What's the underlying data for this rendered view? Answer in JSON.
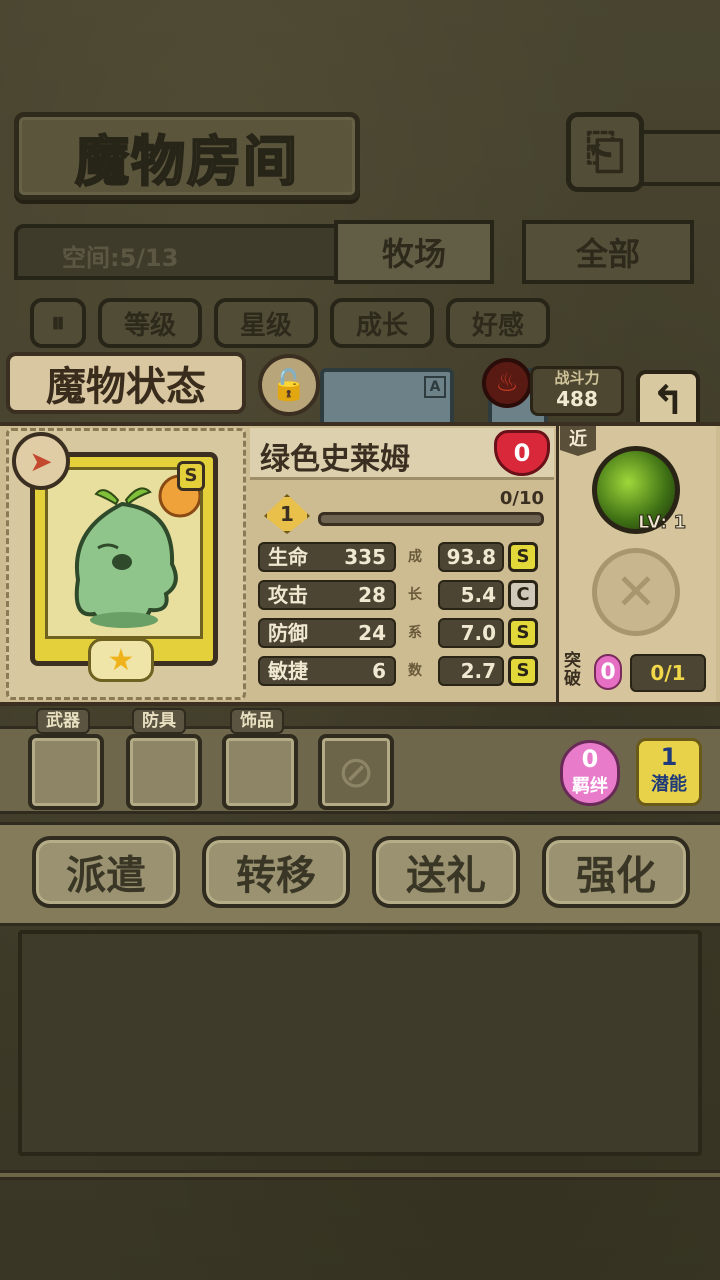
{
  "header": {
    "title": "魔物房间",
    "space": "空间:5/13",
    "tabs": [
      {
        "label": "牧场"
      },
      {
        "label": "全部"
      }
    ],
    "sort_buttons": [
      {
        "label": "等级"
      },
      {
        "label": "星级"
      },
      {
        "label": "成长"
      },
      {
        "label": "好感"
      }
    ]
  },
  "status": {
    "title": "魔物状态",
    "power_label": "战斗力",
    "power_value": "488",
    "monster_name": "绿色史莱姆",
    "affection": "0",
    "level": "1",
    "exp_text": "0/10",
    "exp_progress": 0,
    "rank": "S",
    "card_rank": "A",
    "stars": 1,
    "growth_chars": [
      "成",
      "长",
      "系",
      "数"
    ],
    "stats": [
      {
        "label": "生命",
        "value": "335",
        "growth": "93.8",
        "grade": "S"
      },
      {
        "label": "攻击",
        "value": "28",
        "growth": "5.4",
        "grade": "C"
      },
      {
        "label": "防御",
        "value": "24",
        "growth": "7.0",
        "grade": "S"
      },
      {
        "label": "敏捷",
        "value": "6",
        "growth": "2.7",
        "grade": "S"
      }
    ],
    "range_tag": "近",
    "skill_level": "LV: 1",
    "break_label": "突破",
    "break_count": "0",
    "break_progress": "0/1"
  },
  "equipment": {
    "labels": [
      "武器",
      "防具",
      "饰品"
    ],
    "bond_count": "0",
    "bond_label": "羁绊",
    "potential_count": "1",
    "potential_label": "潜能"
  },
  "actions": [
    {
      "label": "派遣"
    },
    {
      "label": "转移"
    },
    {
      "label": "送礼"
    },
    {
      "label": "强化"
    }
  ],
  "colors": {
    "accent_gold": "#e3d03a",
    "slime_green": "#8fc48a",
    "heart_red": "#d8283a"
  }
}
